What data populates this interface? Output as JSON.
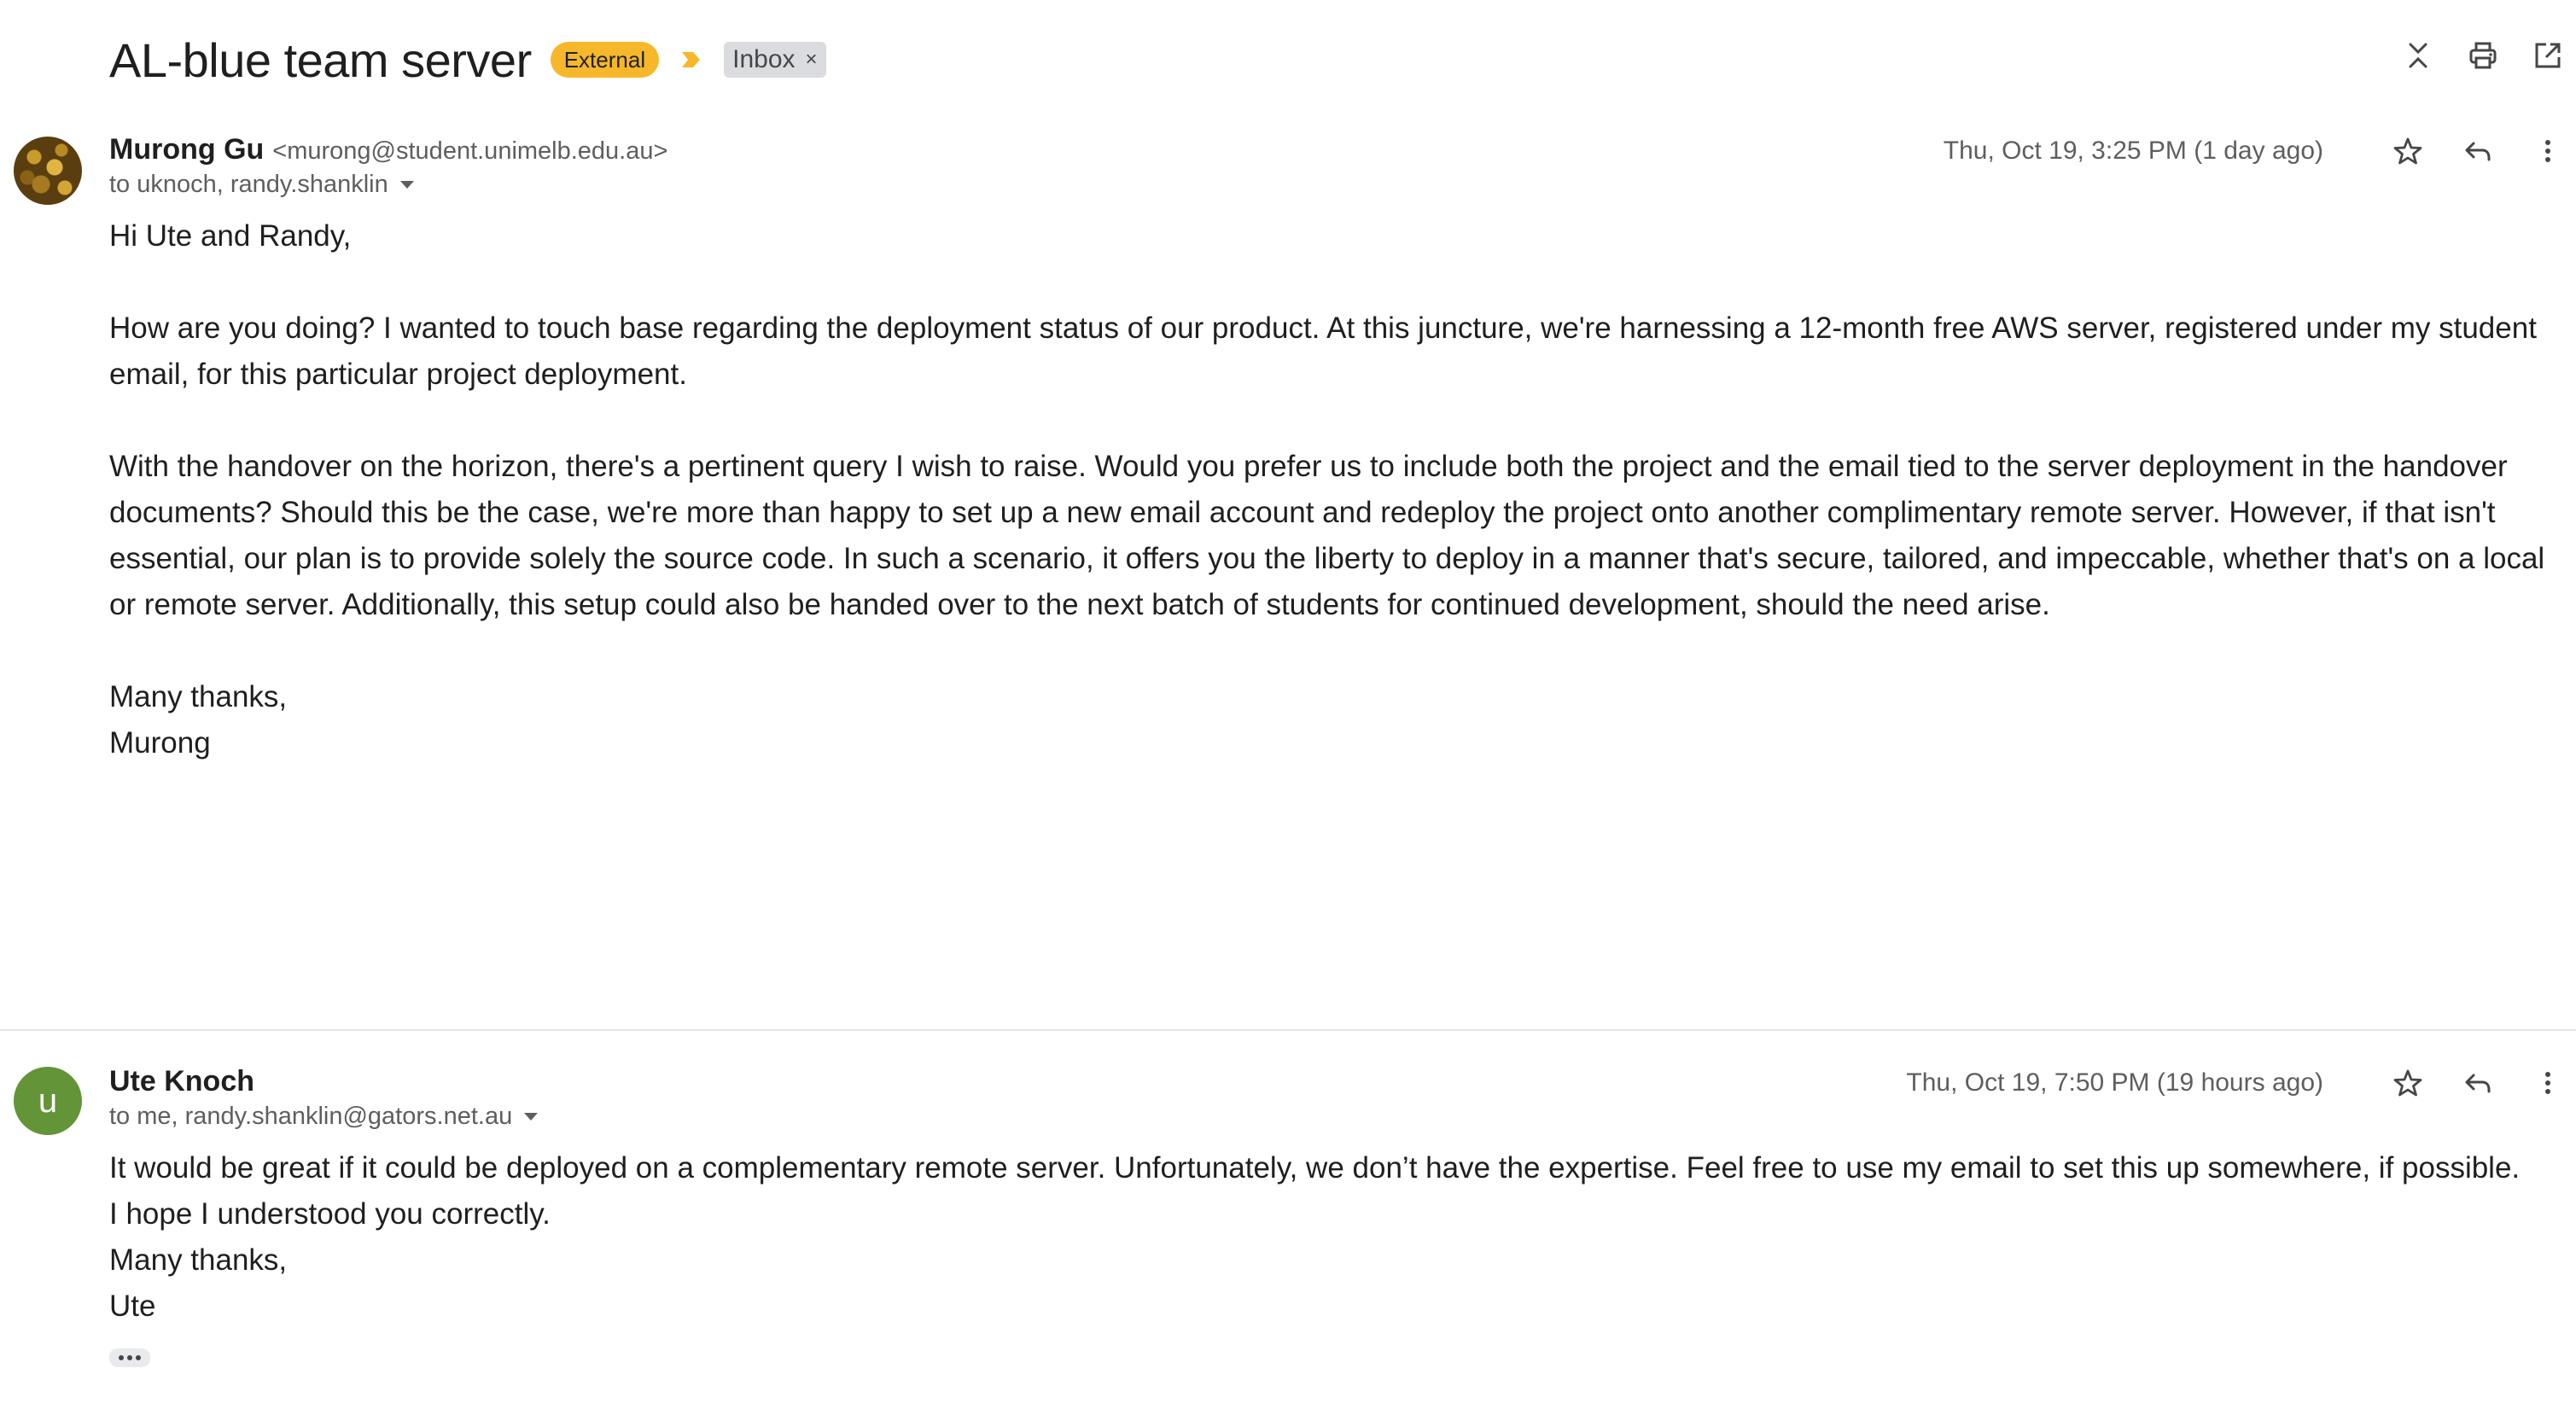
{
  "thread": {
    "subject": "AL-blue team server",
    "labels": {
      "external": "External",
      "inbox": "Inbox",
      "inbox_remove": "×"
    },
    "actions": [
      "collapse-all-icon",
      "print-icon",
      "open-in-new-window-icon"
    ]
  },
  "messages": [
    {
      "sender_name": "Murong Gu",
      "sender_email": "<murong@student.unimelb.edu.au>",
      "to": "to uknoch, randy.shanklin",
      "timestamp": "Thu, Oct 19, 3:25 PM (1 day ago)",
      "avatar": "photo",
      "paragraphs": [
        "Hi Ute and Randy,",
        "How are you doing?  I wanted to touch base regarding the deployment status of our product. At this juncture, we're harnessing a 12-month free AWS server, registered under my student email, for this particular project deployment.",
        "With the handover on the horizon, there's a pertinent query I wish to raise. Would you prefer us to include both the project and the email tied to the server deployment in the handover documents? Should this be the case, we're more than happy to set up a new email account and redeploy the project onto another complimentary remote server. However, if that isn't essential, our plan is to provide solely the source code. In such a scenario, it offers you the liberty to deploy in a manner that's secure, tailored, and impeccable, whether that's on a local or remote server. Additionally, this setup could also be handed over to the next batch of students for continued development, should the need arise.",
        "Many thanks,",
        "Murong"
      ]
    },
    {
      "sender_name": "Ute Knoch",
      "sender_email": "",
      "avatar_letter": "u",
      "avatar_color": "#639437",
      "to": "to me, randy.shanklin@gators.net.au",
      "timestamp": "Thu, Oct 19, 7:50 PM (19 hours ago)",
      "paragraphs": [
        "It would be great if it could be deployed on a complementary remote server. Unfortunately, we don’t have the expertise. Feel free to use my email to set this up somewhere, if possible.",
        "I hope I understood you correctly.",
        "Many thanks,",
        "Ute"
      ]
    }
  ],
  "colors": {
    "external_badge": "#f6b82a",
    "importance_marker": "#f6b82a",
    "inbox_badge": "#dadce0",
    "text": "#1f1f1f",
    "muted": "#5e5e5e"
  }
}
